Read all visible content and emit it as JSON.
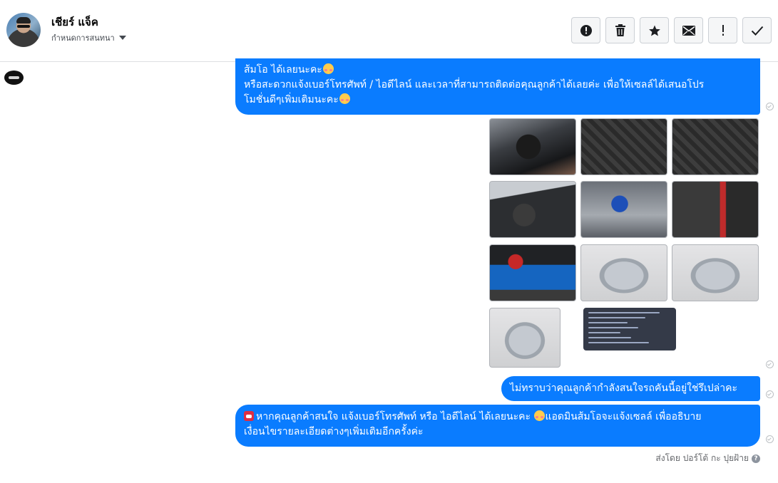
{
  "header": {
    "name": "เชียร์ แจ็ค",
    "subtitle": "กำหนดการสนทนา",
    "actions": [
      {
        "name": "mark-spam-button",
        "icon": "alert-circle-icon"
      },
      {
        "name": "delete-button",
        "icon": "trash-icon"
      },
      {
        "name": "star-button",
        "icon": "star-icon"
      },
      {
        "name": "mark-unread-button",
        "icon": "envelope-icon"
      },
      {
        "name": "follow-up-button",
        "icon": "exclamation-icon"
      },
      {
        "name": "mark-done-button",
        "icon": "check-icon"
      }
    ]
  },
  "messages": {
    "m1": {
      "line1": "ส้มโอ ได้เลยนะคะ",
      "line2": "หรือสะดวกแจ้งเบอร์โทรศัพท์ / ไอดีไลน์ และเวลาที่สามารถติดต่อคุณลูกค้าได้เลยค่ะ เพื่อให้เซลล์ได้เสนอโปร",
      "line3": "โมชั่นดีๆเพิ่มเติมนะคะ"
    },
    "m2": {
      "text": "ไม่ทราบว่าคุณลูกค้ากำลังสนใจรถคันนี้อยู่ใช่รึเปล่าคะ"
    },
    "m3": {
      "line1_a": "หากคุณลูกค้าสนใจ แจ้งเบอร์โทรศัพท์ หรือ ไอดีไลน์  ได้เลยนะคะ",
      "line1_b": "แอดมินส้มโอจะแจ้งเซลล์   เพื่ออธิบาย",
      "line2": "เงื่อนไขรายละเอียดต่างๆเพิ่มเติมอีกครั้งค่ะ"
    }
  },
  "photos": [
    {
      "name": "photo-interior-steering"
    },
    {
      "name": "photo-interior-seats"
    },
    {
      "name": "photo-interior-front-seats"
    },
    {
      "name": "photo-dashboard-console"
    },
    {
      "name": "photo-engine-bay"
    },
    {
      "name": "photo-seat-side"
    },
    {
      "name": "photo-battery"
    },
    {
      "name": "photo-truck-front-left"
    },
    {
      "name": "photo-truck-front"
    },
    {
      "name": "photo-truck-rear"
    },
    {
      "name": "photo-spec-sheet"
    }
  ],
  "footer": {
    "sent_by": "ส่งโดย ปอร์โต้ กะ ปุยฝ้าย",
    "help": "?"
  },
  "colors": {
    "bubble": "#0a7cff",
    "header_border": "#dddfe2",
    "muted_text": "#65676b"
  }
}
